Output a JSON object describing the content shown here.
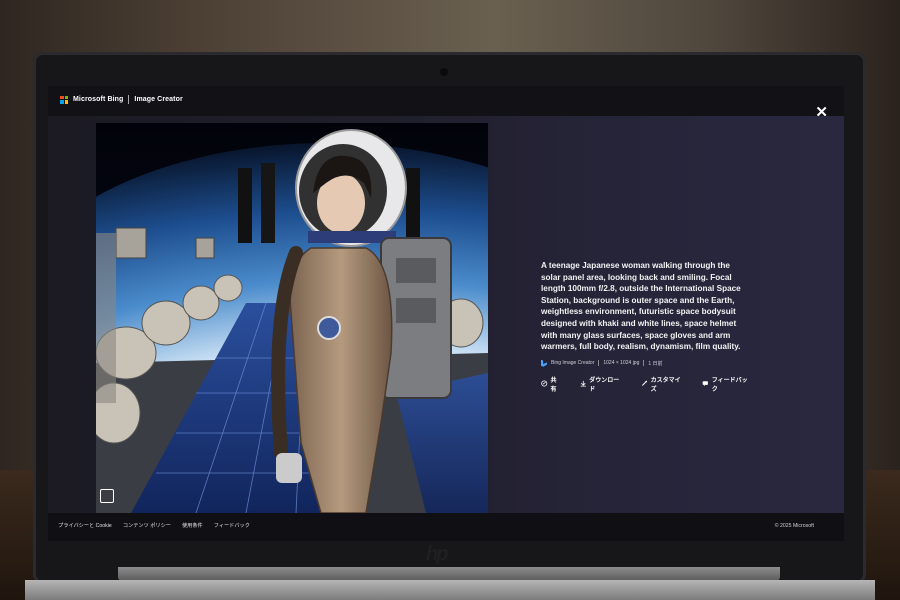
{
  "header": {
    "brand": "Microsoft Bing",
    "product": "Image Creator",
    "close_icon": "close-icon"
  },
  "image": {
    "description": "A teenage Japanese woman walking through the solar panel area, looking back and smiling. Focal length 100mm f/2.8, outside the International Space Station, background is outer space and the Earth, weightless environment, futuristic space bodysuit designed with khaki and white lines, space helmet with many glass surfaces, space gloves and arm warmers, full body, realism, dynamism, film quality.",
    "source": "Bing Image Creator",
    "dimensions": "1024 × 1024 jpg",
    "age": "1 日前",
    "overlay_icon": "image-search-icon"
  },
  "actions": {
    "share": "共有",
    "download": "ダウンロード",
    "customize": "カスタマイズ",
    "feedback": "フィードバック"
  },
  "footer": {
    "links": [
      "プライバシーと Cookie",
      "コンテンツ ポリシー",
      "使用条件",
      "フィードバック"
    ],
    "copyright": "© 2025 Microsoft"
  },
  "device": {
    "logo": "hp"
  },
  "colors": {
    "ms_red": "#f25022",
    "ms_green": "#7fba00",
    "ms_blue": "#00a4ef",
    "ms_yellow": "#ffb900"
  }
}
